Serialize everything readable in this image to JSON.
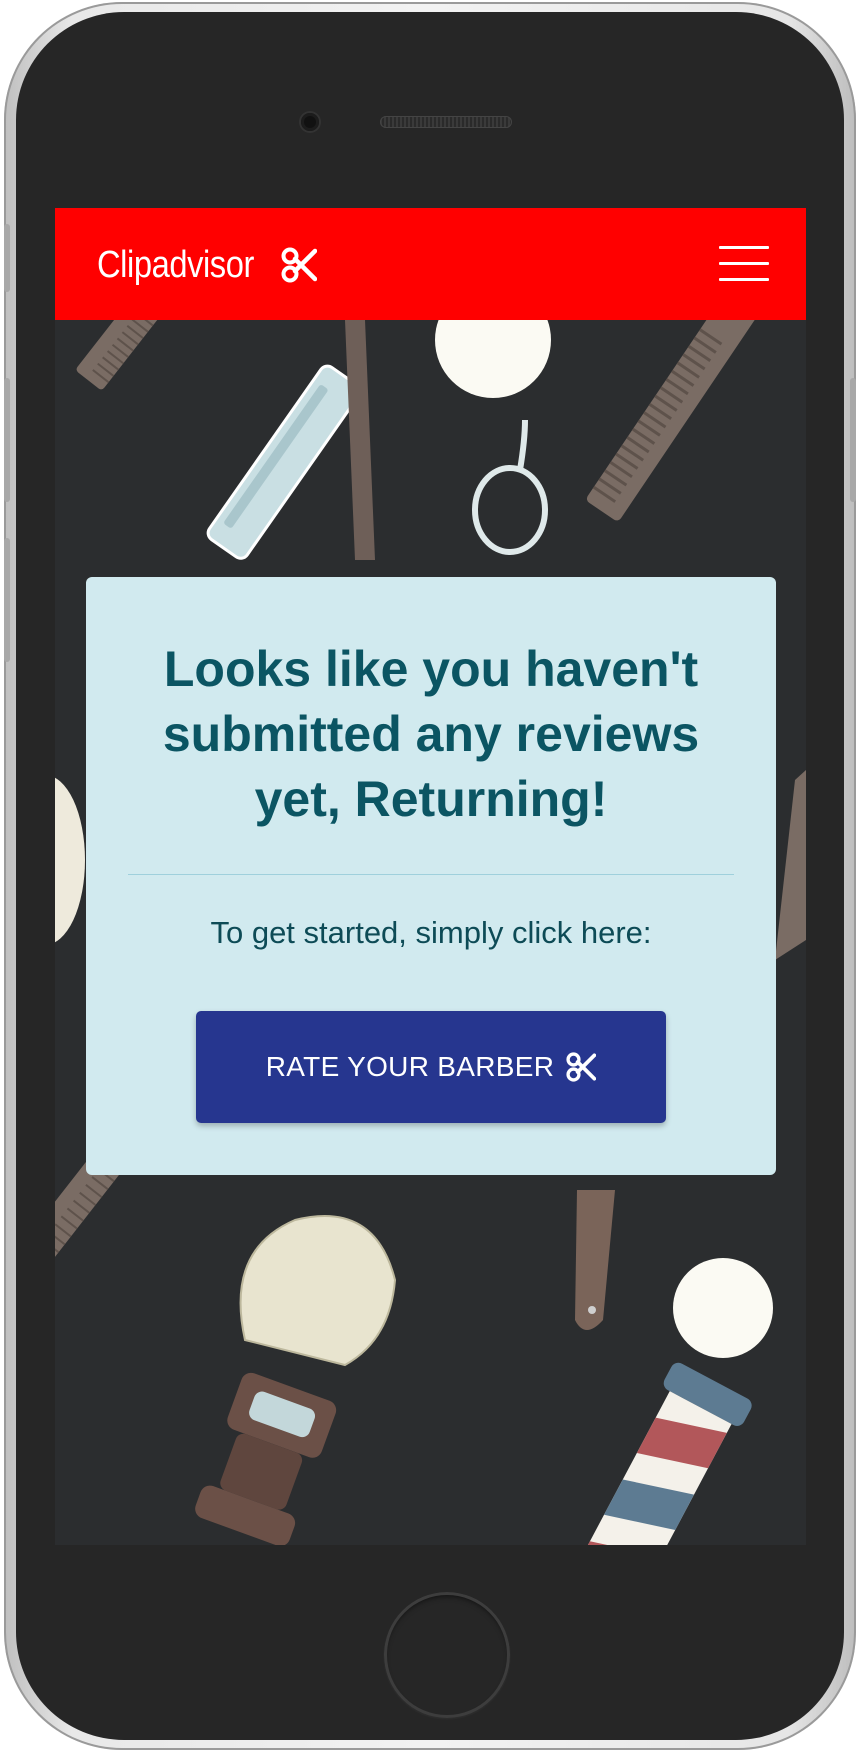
{
  "navbar": {
    "brand_name": "Clipadvisor",
    "brand_icon": "scissors-icon",
    "menu_icon": "hamburger-menu-icon",
    "background_color": "#ff0000"
  },
  "card": {
    "title": "Looks like you haven't submitted any reviews yet, Returning!",
    "prompt": "To get started, simply click here:",
    "button_label": "RATE YOUR BARBER",
    "button_icon": "scissors-icon",
    "background_color": "#d1eaef",
    "title_color": "#0b5563",
    "button_color": "#26368f"
  },
  "background": {
    "illustration": "barber-tools-pattern",
    "color": "#2b2d2f"
  }
}
